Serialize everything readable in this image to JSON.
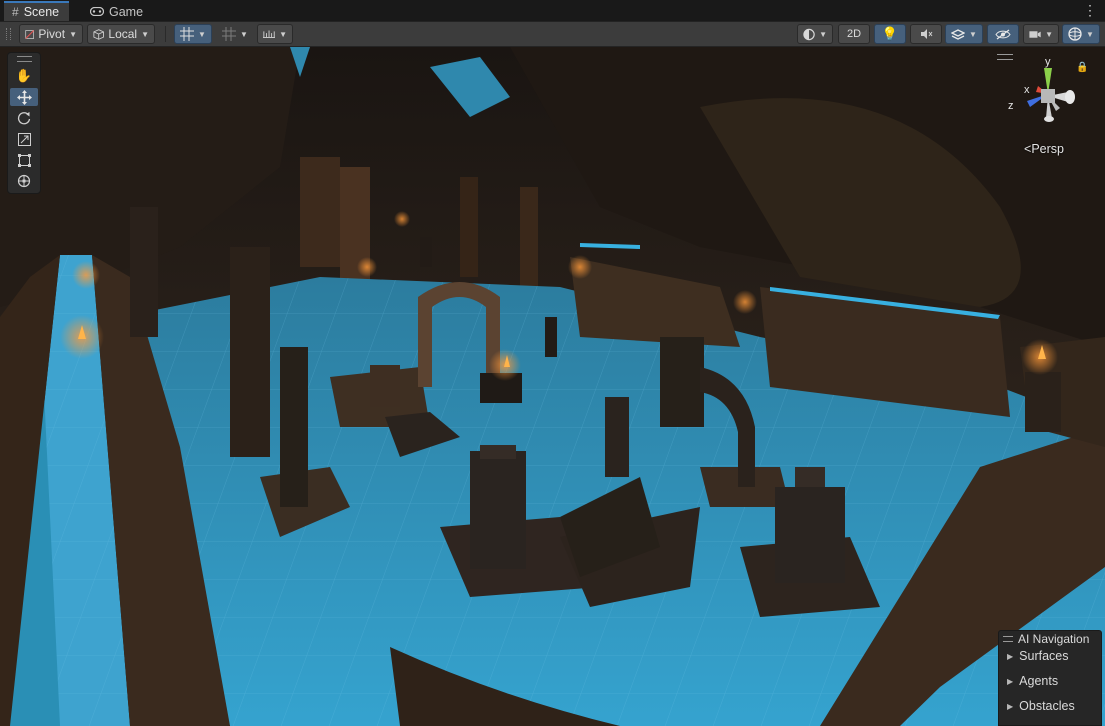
{
  "tabs": [
    {
      "label": "Scene",
      "icon": "grid-icon",
      "active": true
    },
    {
      "label": "Game",
      "icon": "gamepad-icon",
      "active": false
    }
  ],
  "toolbar": {
    "pivot_label": "Pivot",
    "local_label": "Local",
    "mode_2d_label": "2D"
  },
  "tools": [
    {
      "name": "hand-tool",
      "icon": "hand-icon",
      "selected": false
    },
    {
      "name": "move-tool",
      "icon": "move-icon",
      "selected": true
    },
    {
      "name": "rotate-tool",
      "icon": "rotate-icon",
      "selected": false
    },
    {
      "name": "scale-tool",
      "icon": "scale-icon",
      "selected": false
    },
    {
      "name": "rect-tool",
      "icon": "rect-transform-icon",
      "selected": false
    },
    {
      "name": "transform-tool",
      "icon": "transform-icon",
      "selected": false
    }
  ],
  "gizmo": {
    "x_label": "x",
    "y_label": "y",
    "z_label": "z",
    "projection_label": "Persp"
  },
  "ai_navigation": {
    "title": "AI Navigation",
    "items": [
      "Surfaces",
      "Agents",
      "Obstacles"
    ]
  },
  "colors": {
    "navmesh": "#2a8fb5",
    "accent": "#46607c",
    "tab_highlight": "#3a79bb"
  }
}
